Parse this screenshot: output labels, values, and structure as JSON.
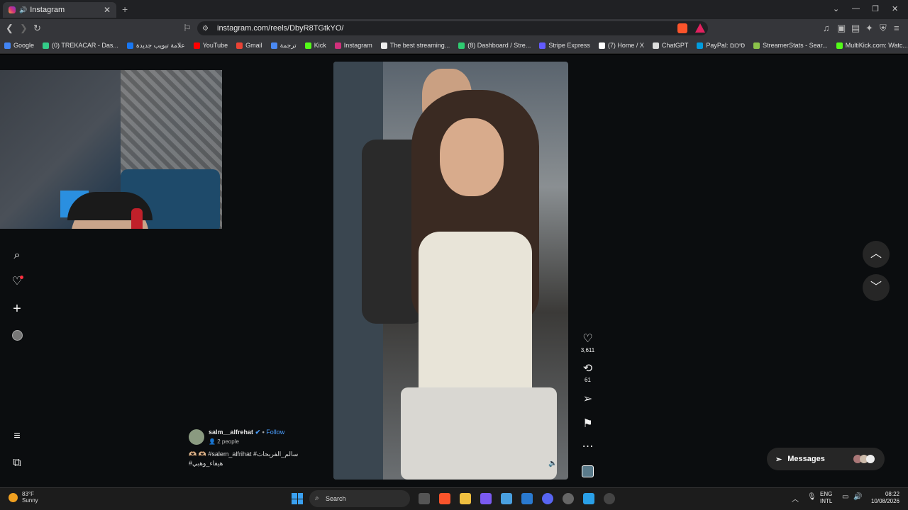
{
  "browser": {
    "tab_title": "Instagram",
    "url": "instagram.com/reels/DbyR8TGtkYO/",
    "bookmarks": [
      {
        "label": "Google",
        "color": "#4285f4"
      },
      {
        "label": "(0) TREKACAR - Das...",
        "color": "#3c8"
      },
      {
        "label": "علامة تبويب جديدة",
        "color": "#1877f2"
      },
      {
        "label": "YouTube",
        "color": "#ff0000"
      },
      {
        "label": "Gmail",
        "color": "#ea4335"
      },
      {
        "label": "ترجمة",
        "color": "#4a89f3"
      },
      {
        "label": "Kick",
        "color": "#53fc18"
      },
      {
        "label": "Instagram",
        "color": "#d1307c"
      },
      {
        "label": "The best streaming...",
        "color": "#eeeeee"
      },
      {
        "label": "(8) Dashboard / Stre...",
        "color": "#2ecc71"
      },
      {
        "label": "Stripe Express",
        "color": "#635bff"
      },
      {
        "label": "(7) Home / X",
        "color": "#ffffff"
      },
      {
        "label": "ChatGPT",
        "color": "#dddddd"
      },
      {
        "label": "PayPal: סיכום",
        "color": "#009cde"
      },
      {
        "label": "StreamerStats - Sear...",
        "color": "#8bc34a"
      },
      {
        "label": "MultiKick.com: Watc...",
        "color": "#53fc18"
      }
    ]
  },
  "reel": {
    "likes": "3,611",
    "reposts": "61",
    "author": "salm__alfrehat",
    "follow_label": "Follow",
    "people": "2 people",
    "caption_line1": "🫶🏼 🫶🏼 #salem_alfrihat #سالم_الفريحات",
    "caption_line2": "#هيفاء_وهبي"
  },
  "messages_label": "Messages",
  "taskbar": {
    "temperature": "83°F",
    "weather": "Sunny",
    "search_placeholder": "Search",
    "lang1": "ENG",
    "lang2": "INTL",
    "time": "08:22",
    "date": "10/08/2026"
  },
  "colors": {
    "accent": "#4a9eff",
    "notification": "#ff3040"
  }
}
